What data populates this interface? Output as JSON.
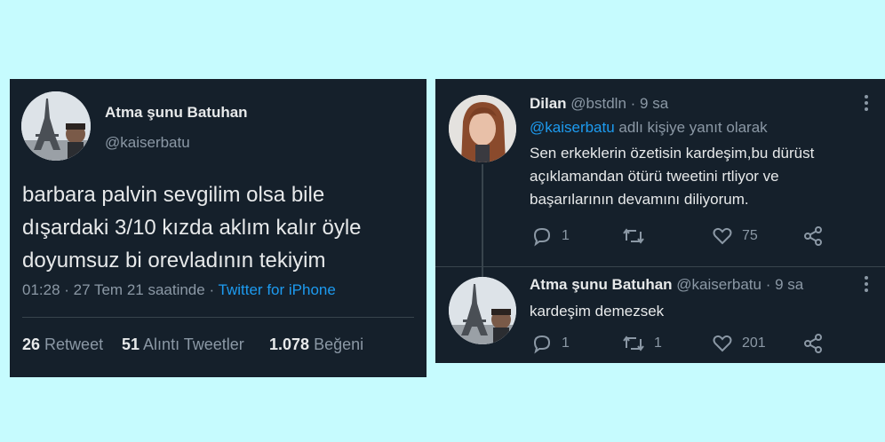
{
  "colors": {
    "background": "#c6fbfe",
    "panel": "#15202b",
    "text": "#e7e9ea",
    "muted": "#8b98a5",
    "accent": "#1d9bf0"
  },
  "main_tweet": {
    "display_name": "Atma şunu Batuhan",
    "handle": "@kaiserbatu",
    "text_lines": [
      "barbara palvin sevgilim olsa bile",
      "dışardaki 3/10 kızda aklım kalır öyle",
      "doyumsuz bi orevladının tekiyim"
    ],
    "time": "01:28 · 27 Tem 21 saatinde · ",
    "client": "Twitter for iPhone",
    "stats": [
      {
        "count": "26",
        "label": "Retweet"
      },
      {
        "count": "51",
        "label": "Alıntı Tweetler"
      },
      {
        "count": "1.078",
        "label": "Beğeni"
      }
    ]
  },
  "replies": [
    {
      "display_name": "Dilan",
      "meta": "@bstdln · 9 sa",
      "reply_to_handle": "@kaiserbatu",
      "reply_to_suffix": " adlı kişiye yanıt olarak",
      "text_lines": [
        "Sen erkeklerin özetisin kardeşim,bu dürüst",
        "açıklamandan ötürü tweetini rtliyor ve",
        "başarılarının devamını diliyorum."
      ],
      "actions": {
        "reply": "1",
        "retweet": "",
        "like": "75"
      }
    },
    {
      "display_name": "Atma şunu Batuhan",
      "meta": "@kaiserbatu · 9 sa",
      "text_lines": [
        "kardeşim demezsek"
      ],
      "actions": {
        "reply": "1",
        "retweet": "1",
        "like": "201"
      }
    }
  ],
  "icons": [
    "reply-icon",
    "retweet-icon",
    "like-icon",
    "share-icon",
    "more-icon"
  ]
}
